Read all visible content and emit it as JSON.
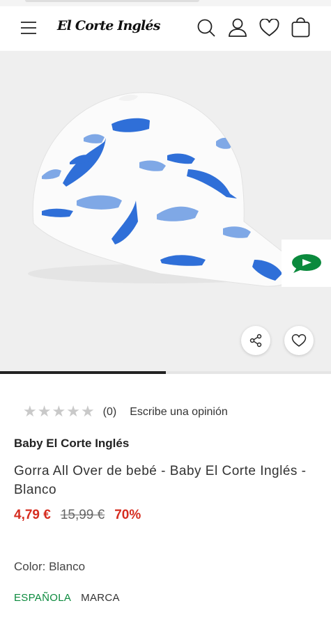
{
  "header": {
    "logo_text": "El Corte Inglés",
    "icons": [
      "menu-icon",
      "search-icon",
      "user-icon",
      "heart-icon",
      "bag-icon"
    ]
  },
  "gallery": {
    "image_progress": 0.5,
    "actions": [
      "share-icon",
      "heart-icon"
    ],
    "chat_icon": "chat-bubble-icon"
  },
  "product": {
    "rating_stars": 5,
    "rating_count": "(0)",
    "review_link": "Escribe una opinión",
    "brand": "Baby El Corte Inglés",
    "title": "Gorra All Over de bebé - Baby El Corte Inglés - Blanco",
    "price_current": "4,79 €",
    "price_original": "15,99 €",
    "discount": "70%",
    "color_label": "Color: Blanco",
    "tags": [
      "ESPAÑOLA",
      "MARCA"
    ]
  },
  "colors": {
    "accent_red": "#d62d20",
    "tag_green": "#0b8a3d",
    "whale_blue": "#2f6fd8",
    "chat_green": "#0b8a3d"
  }
}
